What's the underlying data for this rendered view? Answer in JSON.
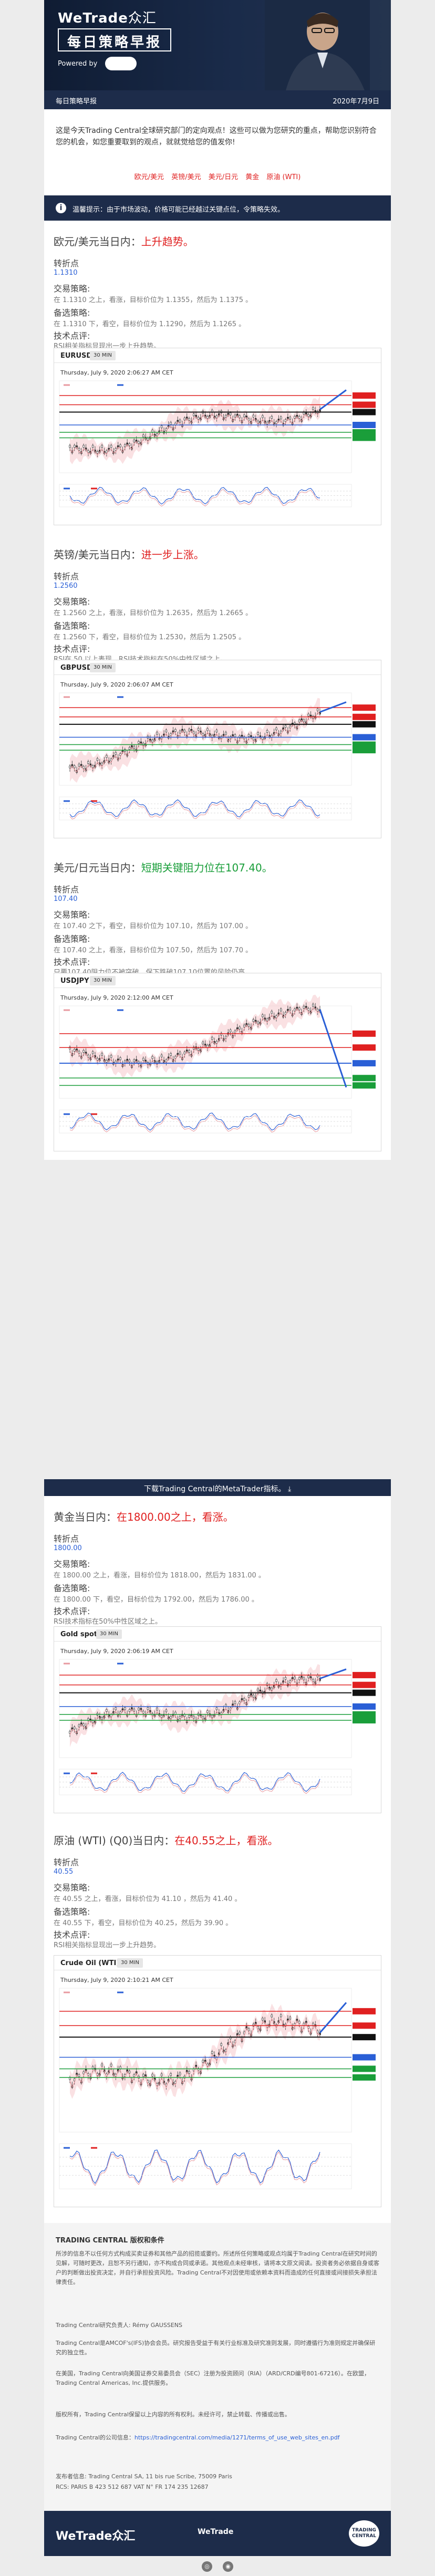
{
  "header": {
    "brand": "WeTrade",
    "brand_cn": "众汇",
    "title": "每日策略早报",
    "powered_by": "Powered by",
    "partner_logo": "TRADING CENTRAL"
  },
  "date_bar": {
    "left": "每日策略早报",
    "right": "2020年7月9日"
  },
  "intro": {
    "text": "这是今天Trading Central全球研究部门的定向观点！这些可以做为您研究的重点，帮助您识别符合您的机会，如您重要取到的观点，就就觉给您的值发你!",
    "links": [
      "欧元/美元",
      "英镑/美元",
      "美元/日元",
      "黄金",
      "原油 (WTI)"
    ]
  },
  "notice": {
    "icon": "i",
    "text": "温馨提示：由于市场波动，价格可能已经越过关键点位，令策略失效。"
  },
  "sections": [
    {
      "pair": "欧元/美元",
      "label": "当日内：",
      "headline": "上升趋势。",
      "pivot_label": "转折点",
      "pivot": "1.1310",
      "trade_label": "交易策略:",
      "trade": "在 1.1310 之上，看涨，目标价位为 1.1355，然后为 1.1375 。",
      "alt_label": "备选策略:",
      "alt": "在 1.1310 下，看空，目标价位为 1.1290，然后为 1.1265 。",
      "tech_label": "技术点评:",
      "tech": "RSI相关指标显现出一步上升趋势。",
      "chart": {
        "symbol": "EURUSD",
        "tf": "30 MIN",
        "date": "Thursday, July 9, 2020 2:06:27 AM CET",
        "copyright": "Source:© © 2020 Trading Central"
      }
    },
    {
      "pair": "英镑/美元",
      "label": "当日内：",
      "headline": "进一步上涨。",
      "pivot_label": "转折点",
      "pivot": "1.2560",
      "trade_label": "交易策略:",
      "trade": "在 1.2560 之上，看涨，目标价位为 1.2635，然后为 1.2665 。",
      "alt_label": "备选策略:",
      "alt": "在 1.2560 下，看空，目标价位为 1.2530，然后为 1.2505 。",
      "tech_label": "技术点评:",
      "tech": "RSI在 50 以上表现，RSI技术指标在50%中性区域之上。",
      "chart": {
        "symbol": "GBPUSD",
        "tf": "30 MIN",
        "date": "Thursday, July 9, 2020 2:06:07 AM CET",
        "copyright": "Source:© © 2020 Trading Central"
      }
    },
    {
      "pair": "美元/日元",
      "label": "当日内：",
      "headline": "短期关键阻力位在107.40。",
      "pivot_label": "转折点",
      "pivot": "107.40",
      "trade_label": "交易策略:",
      "trade": "在 107.40 之下，看空，目标价位为 107.10，然后为 107.00 。",
      "alt_label": "备选策略:",
      "alt": "在 107.40 之上，看涨，目标价位为 107.50，然后为 107.70 。",
      "tech_label": "技术点评:",
      "tech": "只要107.40阻力位不被突破，保下跌破107.10位置的风险仍高。",
      "chart": {
        "symbol": "USDJPY",
        "tf": "30 MIN",
        "date": "Thursday, July 9, 2020 2:12:00 AM CET",
        "copyright": "Source:© © 2020 Trading Central"
      }
    },
    {
      "pair": "黄金",
      "label": "当日内：",
      "headline": "在1800.00之上，看涨。",
      "pivot_label": "转折点",
      "pivot": "1800.00",
      "trade_label": "交易策略:",
      "trade": "在 1800.00 之上，看涨，目标价位为 1818.00，然后为 1831.00 。",
      "alt_label": "备选策略:",
      "alt": "在 1800.00 下，看空，目标价位为 1792.00，然后为 1786.00 。",
      "tech_label": "技术点评:",
      "tech": "RSI技术指标在50%中性区域之上。",
      "chart": {
        "symbol": "Gold spot",
        "tf": "30 MIN",
        "date": "Thursday, July 9, 2020 2:06:19 AM CET",
        "copyright": "Source:© © 2020 Trading Central"
      }
    },
    {
      "pair": "原油 (WTI) (Q0)",
      "label": "当日内：",
      "headline": "在40.55之上，看涨。",
      "pivot_label": "转折点",
      "pivot": "40.55",
      "trade_label": "交易策略:",
      "trade": "在 40.55 之上，看涨，目标价位为 41.10 ，然后为 41.40 。",
      "alt_label": "备选策略:",
      "alt": "在 40.55 下，看空，目标价位为 40.25，然后为 39.90 。",
      "tech_label": "技术点评:",
      "tech": "RSI相关指标显现出一步上升趋势。",
      "chart": {
        "symbol": "Crude Oil (WTI)",
        "tf": "30 MIN",
        "date": "Thursday, July 9, 2020 2:10:21 AM CET",
        "copyright": "Source:© © 2020 Trading Central"
      }
    }
  ],
  "download_bar": {
    "text": "下载Trading Central的MetaTrader指标。",
    "icon": "download-icon"
  },
  "footer": {
    "heading": "TRADING CENTRAL 版权和条件",
    "p1": "所涉的信息不以任何方式构成买卖证券和其他产品的招揽或要约。所述所任何策略或观点均属于Trading Central在研究时间的见解，可随时更改，且恕不另行通知，亦不构成合同或承诺。其他观点未经审核，请将本文原文阅读。投资者务必依据自身或客户的判断做出投资决定，并自行承担投资风险。Trading Central不对因使用或依赖本资料而造成的任何直接或间接损失承担法律责任。",
    "p2": "Trading Central研究负责人: Rémy GAUSSENS",
    "p3": "Trading Central是AMCOF's(IFS)协会会员。研究报告受益于有关行业标准及研究准则发展，同时遵循行为准则规定并确保研究的独立性。",
    "p4": "在美国，Trading Central向美国证券交易委员会（SEC）注册为投资顾问（RIA）（ARD/CRD编号801-67216）。在欧盟，Trading Central Americas, Inc.提供服务。",
    "p5": "版权所有，Trading Central保留以上内容的所有权利。未经许可，禁止转载、传播或出售。",
    "p6_label": "Trading Central的公司信息：",
    "p6_link": "https://tradingcentral.com/media/1271/terms_of_use_web_sites_en.pdf",
    "p7": "发布者信息: Trading Central SA, 11 bis rue Scribe, 75009 Paris",
    "p8": "RCS: PARIS B 423 512 687 VAT N° FR 174 235 12687"
  },
  "bottom": {
    "brand": "WeTrade众汇",
    "mid": "WeTrade",
    "logo": "TRADING CENTRAL"
  }
}
